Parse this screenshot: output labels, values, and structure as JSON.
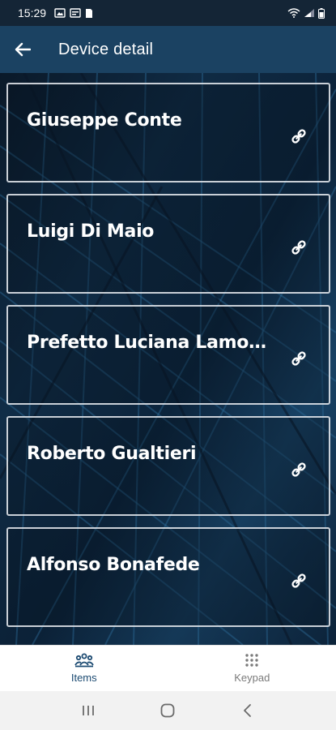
{
  "status_bar": {
    "time": "15:29",
    "left_icons": [
      "image-icon",
      "message-icon",
      "sim-icon"
    ],
    "right_icons": [
      "wifi-icon",
      "signal-icon",
      "battery-icon"
    ]
  },
  "app_bar": {
    "title": "Device detail",
    "back_icon": "arrow-left-icon"
  },
  "items": [
    {
      "name": "Giuseppe Conte"
    },
    {
      "name": "Luigi Di Maio"
    },
    {
      "name": "Prefetto Luciana Lamor..."
    },
    {
      "name": "Roberto Gualtieri"
    },
    {
      "name": "Alfonso Bonafede"
    }
  ],
  "item_icon": "link-icon",
  "bottom_nav": {
    "items_label": "Items",
    "keypad_label": "Keypad",
    "active": "Items"
  },
  "system_nav": [
    "recents-icon",
    "home-icon",
    "back-icon"
  ],
  "colors": {
    "app_bar": "#1b4262",
    "status_bar": "#142536",
    "active_tab": "#1d4b72",
    "inactive_tab": "#7a7a7a"
  }
}
